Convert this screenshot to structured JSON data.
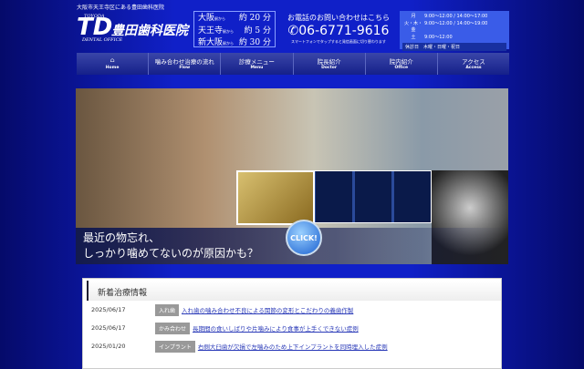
{
  "tagline": "大阪市天王寺区にある豊田歯科医院",
  "logo": {
    "mark": "TD",
    "top": "TOYODA",
    "name": "豊田歯科医院",
    "sub": "DENTAL OFFICE"
  },
  "access": [
    {
      "st": "大阪",
      "from": "駅から",
      "time": "約 20 分"
    },
    {
      "st": "天王寺",
      "from": "駅から",
      "time": "約 5 分"
    },
    {
      "st": "新大阪",
      "from": "駅から",
      "time": "約 30 分"
    }
  ],
  "tel": {
    "label": "お電話のお問い合わせはこちら",
    "number": "06-6771-9616",
    "note": "スマートフォンでタップすると発信画面に切り替わります"
  },
  "hours": {
    "rows": [
      {
        "day": "月",
        "time": "9:00〜12:00 / 14:00〜17:00"
      },
      {
        "day": "火・木・金",
        "time": "9:00〜12:00 / 14:00〜19:00"
      },
      {
        "day": "土",
        "time": "9:00〜12:00"
      }
    ],
    "closed": "休診日　木曜・日曜・祝日"
  },
  "nav": [
    {
      "jp": "",
      "en": "Home"
    },
    {
      "jp": "噛み合わせ治療の流れ",
      "en": "Flow"
    },
    {
      "jp": "診療メニュー",
      "en": "Menu"
    },
    {
      "jp": "院長紹介",
      "en": "Doctor"
    },
    {
      "jp": "院内紹介",
      "en": "Office"
    },
    {
      "jp": "アクセス",
      "en": "Access"
    }
  ],
  "hero": {
    "line1": "最近の物忘れ、",
    "line2": "しっかり噛めてないのが原因かも？",
    "click": "CLICK!"
  },
  "news": {
    "title": "新着治療情報",
    "items": [
      {
        "date": "2025/06/17",
        "cat": "入れ歯",
        "title": "入れ歯の噛み合わせ不良による関節の変形とこだわりの義歯作製"
      },
      {
        "date": "2025/06/17",
        "cat": "かみ合わせ",
        "title": "長期間の食いしばりや片噛みにより食事が上手くできない症例"
      },
      {
        "date": "2025/01/20",
        "cat": "インプラント",
        "title": "右側大臼歯が欠損で左噛みのため上下インプラントを同時埋入した症例"
      }
    ]
  }
}
